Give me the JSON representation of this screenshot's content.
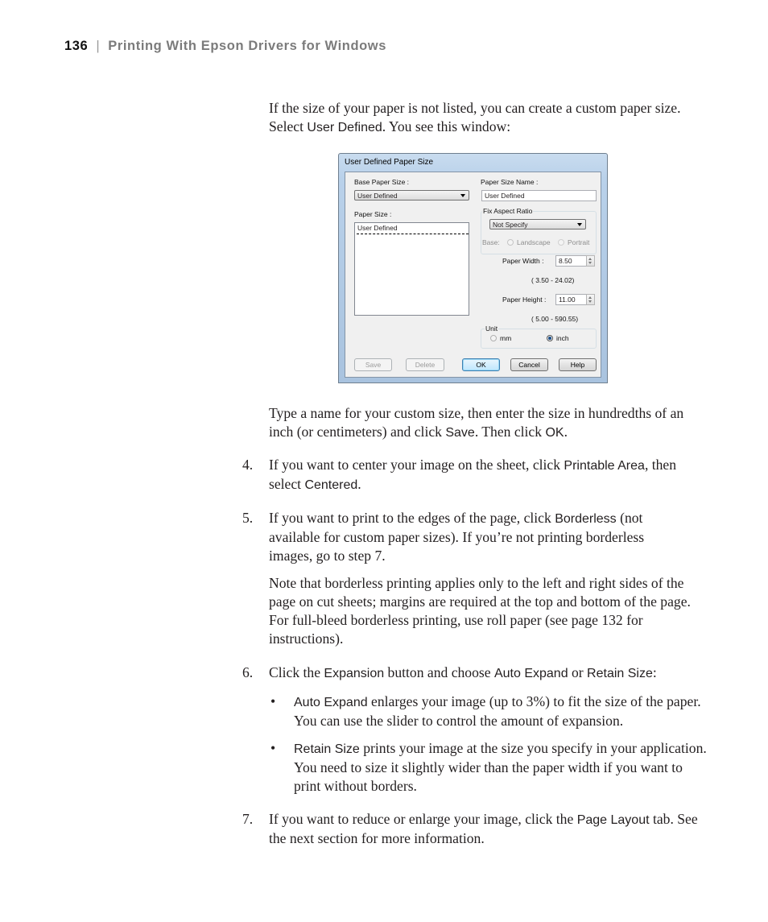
{
  "header": {
    "page_number": "136",
    "separator": "|",
    "chapter_title": "Printing With Epson Drivers for Windows"
  },
  "intro": {
    "text_1": "If the size of your paper is not listed, you can create a custom paper size. Select ",
    "ui_1": "User Defined",
    "text_2": ". You see this window:"
  },
  "dialog": {
    "title": "User Defined Paper Size",
    "base_paper_size_label": "Base Paper Size :",
    "base_paper_size_value": "User Defined",
    "paper_size_label": "Paper Size :",
    "paper_size_list": [
      "User Defined"
    ],
    "paper_size_name_label": "Paper Size Name :",
    "paper_size_name_value": "User Defined",
    "fix_aspect_ratio_label": "Fix Aspect Ratio",
    "fix_aspect_ratio_value": "Not Specify",
    "base_label": "Base:",
    "landscape_label": "Landscape",
    "portrait_label": "Portrait",
    "paper_width_label": "Paper Width  :",
    "paper_width_value": "8.50",
    "paper_width_range": "( 3.50 - 24.02)",
    "paper_height_label": "Paper Height :",
    "paper_height_value": "11.00",
    "paper_height_range": "( 5.00 - 590.55)",
    "unit_label": "Unit",
    "unit_mm_label": "mm",
    "unit_inch_label": "inch",
    "unit_selected": "inch",
    "buttons": {
      "save": "Save",
      "delete": "Delete",
      "ok": "OK",
      "cancel": "Cancel",
      "help": "Help"
    }
  },
  "after_dialog": {
    "text_1": "Type a name for your custom size, then enter the size in hundredths of an inch (or centimeters) and click ",
    "ui_1": "Save",
    "text_2": ". Then click ",
    "ui_2": "OK",
    "text_3": "."
  },
  "steps": [
    {
      "number": "4.",
      "text_1": "If you want to center your image on the sheet, click ",
      "ui_1": "Printable Area",
      "text_2": ", then select ",
      "ui_2": "Centered",
      "text_3": "."
    },
    {
      "number": "5.",
      "text_1": "If you want to print to the edges of the page, click ",
      "ui_1": "Borderless",
      "text_2": " (not available for custom paper sizes). If you’re not printing borderless images, go to step 7.",
      "note": "Note that borderless printing applies only to the left and right sides of the page on cut sheets; margins are required at the top and bottom of the page. For full-bleed borderless printing, use roll paper (see page 132 for instructions)."
    },
    {
      "number": "6.",
      "text_1": "Click the ",
      "ui_1": "Expansion",
      "text_2": " button and choose ",
      "ui_2": "Auto Expand",
      "text_3": " or ",
      "ui_3": "Retain Size",
      "text_4": ":",
      "bullets": [
        {
          "symbol": "•",
          "ui": "Auto Expand",
          "text": " enlarges your image (up to 3%) to fit the size of the paper. You can use the slider to control the amount of expansion."
        },
        {
          "symbol": "•",
          "ui": "Retain Size",
          "text": " prints your image at the size you specify in your application. You need to size it slightly wider than the paper width if you want to print without borders."
        }
      ]
    },
    {
      "number": "7.",
      "text_1": "If you want to reduce or enlarge your image, click the ",
      "ui_1": "Page Layout",
      "text_2": " tab. See the next section for more information."
    }
  ]
}
